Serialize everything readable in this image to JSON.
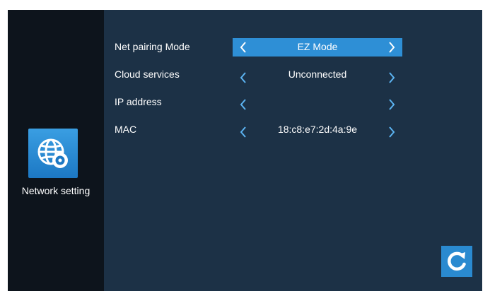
{
  "sidebar": {
    "app": {
      "label": "Network setting",
      "icon": "network-globe-gear-icon"
    }
  },
  "settings": {
    "rows": [
      {
        "label": "Net pairing Mode",
        "value": "EZ Mode",
        "selected": true
      },
      {
        "label": "Cloud services",
        "value": "Unconnected",
        "selected": false
      },
      {
        "label": "IP address",
        "value": "",
        "selected": false
      },
      {
        "label": "MAC",
        "value": "18:c8:e7:2d:4a:9e",
        "selected": false
      }
    ]
  },
  "actions": {
    "refresh_icon": "refresh-icon"
  },
  "colors": {
    "panel_bg": "#1c3146",
    "sidebar_bg": "#0d141c",
    "highlight": "#2e8fd6",
    "accent": "#5cb4f2"
  }
}
